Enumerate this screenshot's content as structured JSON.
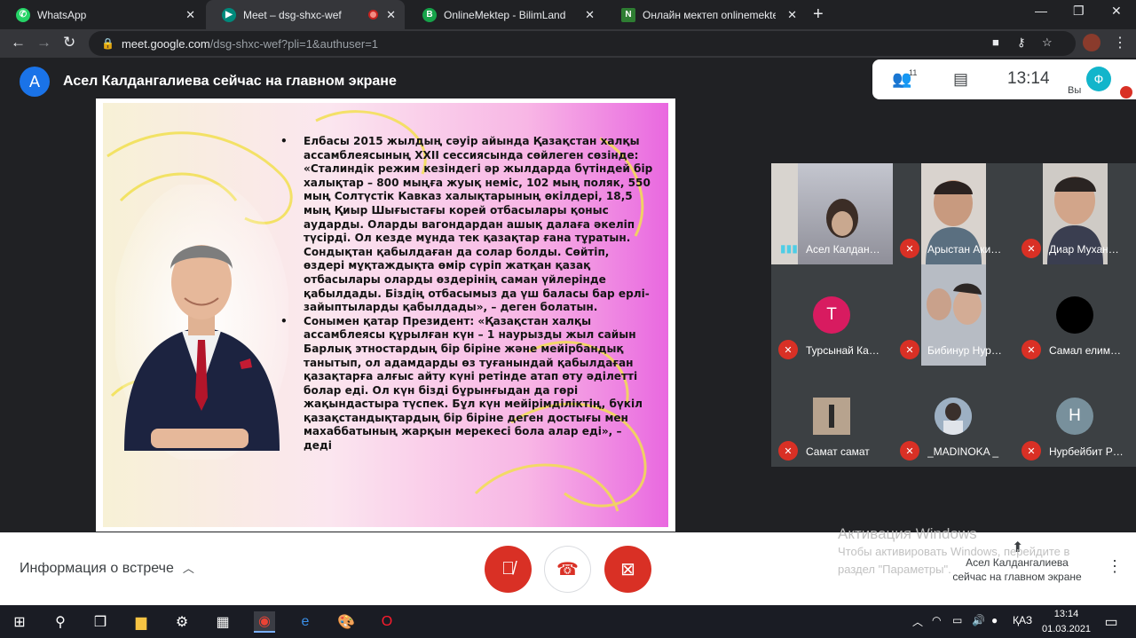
{
  "browser": {
    "tabs": [
      {
        "label": "WhatsApp",
        "favicon": "whatsapp-icon",
        "color": "#25d366"
      },
      {
        "label": "Meet – dsg-shxc-wef",
        "favicon": "meet-icon",
        "color": "#00897b",
        "active": true,
        "recording": true
      },
      {
        "label": "OnlineMektep - BilimLand",
        "favicon": "bilimland-icon",
        "color": "#16a34a"
      },
      {
        "label": "Онлайн мектеп onlinemektep |",
        "favicon": "n-icon",
        "color": "#2e7d32",
        "glyph": "N"
      }
    ],
    "url_host": "meet.google.com",
    "url_path": "/dsg-shxc-wef?pli=1&authuser=1"
  },
  "meeting": {
    "presenter_initial": "A",
    "presenter_text": "Асел Калдангалиева сейчас на главном экране",
    "participant_count": "11",
    "time": "13:14",
    "self_initial": "Ф",
    "self_label": "Вы"
  },
  "slide": {
    "bullets": [
      "Елбасы 2015 жылдың сәуір айында Қазақстан халқы ассамблеясының XXII сессиясында сөйлеген сөзінде: «Сталиндік режим кезіндегі әр жылдарда бүтіндей бір халықтар – 800 мыңға жуық неміс, 102 мың поляк, 550 мың Солтүстік Кавказ халықтарының өкілдері, 18,5 мың Қиыр Шығыстағы корей отбасылары қоныс аударды. Оларды вагондардан ашық далаға әкеліп түсірді. Ол кезде мұнда тек қазақтар ғана тұратын. Сондықтан қабылдаған да солар болды. Сөйтіп, өздері мұқтаждықта өмір сүріп жатқан қазақ отбасылары оларды өздерінің саман үйлерінде қабылдады. Біздің отбасымыз да үш баласы бар ерлі-зайыптыларды қабылдады», – деген болатын.",
      "Сонымен қатар Президент: «Қазақстан халқы ассамблеясы құрылған күн – 1 наурызды жыл сайын Барлық этностардың бір біріне және мейірбандық танытып, ол адамдарды өз туғанындай қабылдаған қазақтарға алғыс айту күні ретінде атап өту әділетті болар еді. Ол күн бізді бұрынғыдан да гөрі жақындастыра түспек. Бұл күн мейірімділіктің, бүкіл қазақстандықтардың бір біріне деген достығы мен махаббатының жарқын мерекесі бола алар еді», – деді"
    ]
  },
  "participants": [
    {
      "name": "Асел Калдан…",
      "muted": false,
      "type": "video"
    },
    {
      "name": "Арыстан Аки…",
      "muted": true,
      "type": "video"
    },
    {
      "name": "Диар Мухан…",
      "muted": true,
      "type": "video"
    },
    {
      "name": "Турсынай Ка…",
      "muted": true,
      "type": "avatar",
      "initial": "Т",
      "color": "#d81b60"
    },
    {
      "name": "Бибинур Нур…",
      "muted": true,
      "type": "video"
    },
    {
      "name": "Самал елим…",
      "muted": true,
      "type": "avatar",
      "initial": "",
      "color": "#000000"
    },
    {
      "name": "Самат самат",
      "muted": true,
      "type": "photo",
      "color": "#7a6a5a"
    },
    {
      "name": "_MADINOKA _",
      "muted": true,
      "type": "photo",
      "color": "#8fa3b8"
    },
    {
      "name": "Нурбейбит Р…",
      "muted": true,
      "type": "avatar",
      "initial": "Н",
      "color": "#78909c"
    }
  ],
  "controls": {
    "info_label": "Информация о встрече",
    "presenting_line1": "Асел Калдангалиева",
    "presenting_line2": "сейчас на главном экране"
  },
  "watermark": {
    "title": "Активация Windows",
    "line1": "Чтобы активировать Windows, перейдите в",
    "line2": "раздел \"Параметры\"."
  },
  "taskbar": {
    "lang": "ҚАЗ",
    "time": "13:14",
    "date": "01.03.2021"
  }
}
